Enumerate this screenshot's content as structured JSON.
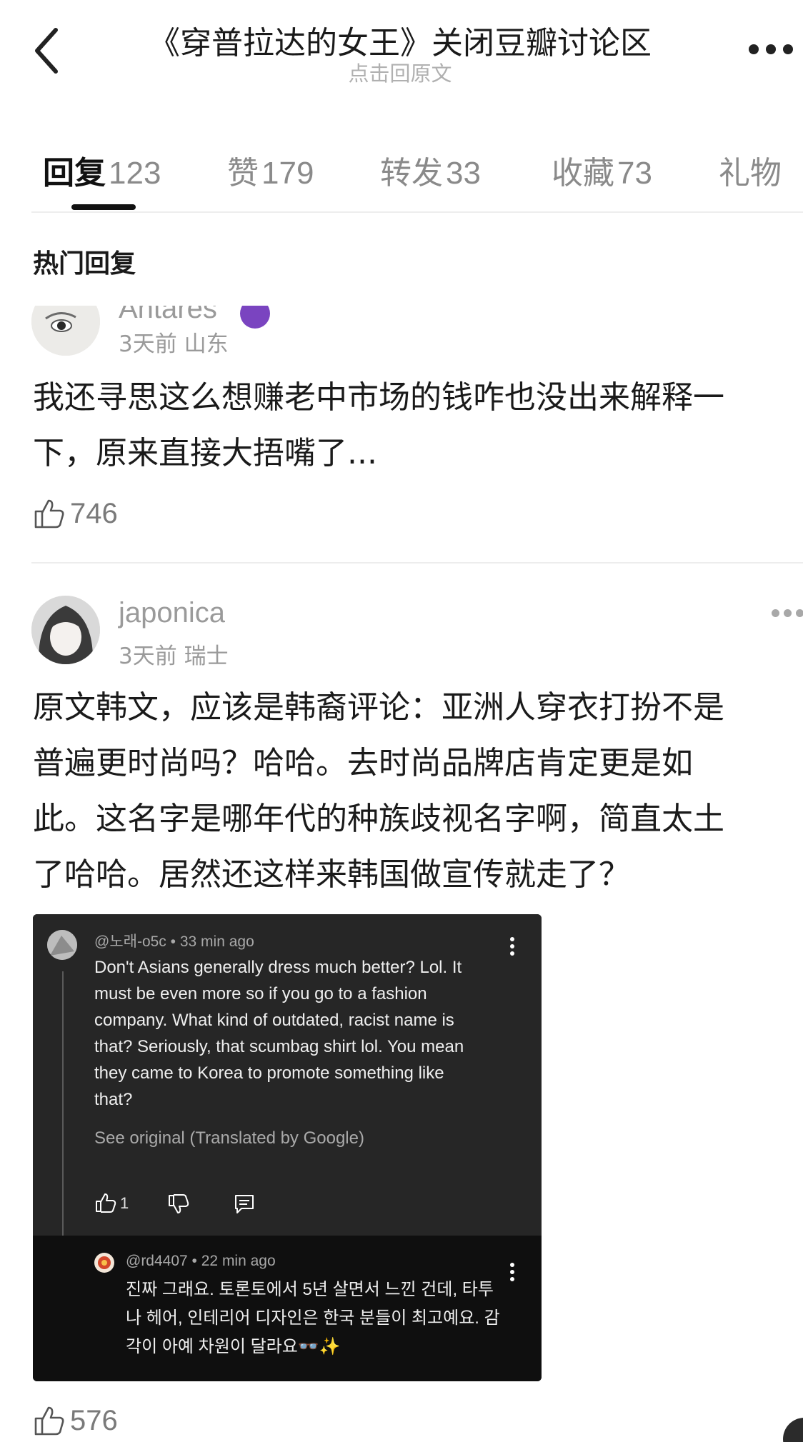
{
  "header": {
    "title": "《穿普拉达的女王》关闭豆瓣讨论区",
    "subtitle": "点击回原文"
  },
  "tabs": [
    {
      "label": "回复",
      "count": "123",
      "active": true
    },
    {
      "label": "赞",
      "count": "179"
    },
    {
      "label": "转发",
      "count": "33"
    },
    {
      "label": "收藏",
      "count": "73"
    },
    {
      "label": "礼物",
      "count": ""
    }
  ],
  "section_title": "热门回复",
  "comments": [
    {
      "username": "Antares",
      "meta": "3天前 山东",
      "text_lines": [
        "我还寻思这么想赚老中市场的钱咋也没出来解释一",
        "下，原来直接大捂嘴了..."
      ],
      "likes": "746"
    },
    {
      "username": "japonica",
      "meta": "3天前 瑞士",
      "text_lines": [
        "原文韩文，应该是韩裔评论：亚洲人穿衣打扮不是",
        "普遍更时尚吗？哈哈。去时尚品牌店肯定更是如",
        "此。这名字是哪年代的种族歧视名字啊，简直太土",
        "了哈哈。居然还这样来韩国做宣传就走了？"
      ],
      "likes": "576"
    }
  ],
  "embed": {
    "handle": "@노래-o5c",
    "time": "33 min ago",
    "text_lines": [
      "Don't Asians generally dress much better? Lol. It",
      "must be even more so if you go to a fashion",
      "company. What kind of outdated, racist name is",
      "that? Seriously, that scumbag shirt lol. You mean",
      "they came to Korea to promote something like",
      "that?"
    ],
    "see_original": "See original (Translated by Google)",
    "likes": "1",
    "reply": {
      "handle": "@rd4407",
      "time": "22 min ago",
      "text_lines": [
        "진짜 그래요. 토론토에서 5년 살면서 느낀 건데, 타투",
        "나 헤어, 인테리어 디자인은 한국 분들이 최고예요. 감",
        "각이 아예 차원이 달라요"
      ],
      "emoji": "👓✨"
    }
  }
}
